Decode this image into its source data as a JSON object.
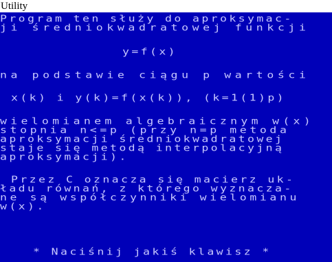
{
  "window": {
    "title": "Utility"
  },
  "screen": {
    "background_color": "#0000b8",
    "text_color": "#c8c8ff",
    "lines": [
      "Program ten służy do aproksymac-",
      "ji średniokwadratowej funkcji",
      "y=f(x)",
      "na podstawie ciągu p wartości",
      "x(k) i y(k)=f(x(k)), (k=1(1)p)",
      "wielomianem algebraicznym w(x)",
      "stopnia n<=p (przy n=p metoda",
      "aproksymacji średniokwadratowej",
      "staje się metodą interpolacyjną",
      "aproksymacji).",
      "Przez C oznacza się macierz uk-",
      "ładu równań, z którego wyznacza-",
      "ne są współczynniki wielomianu",
      "w(x).",
      "* Naciśnij jakiś klawisz *"
    ]
  }
}
